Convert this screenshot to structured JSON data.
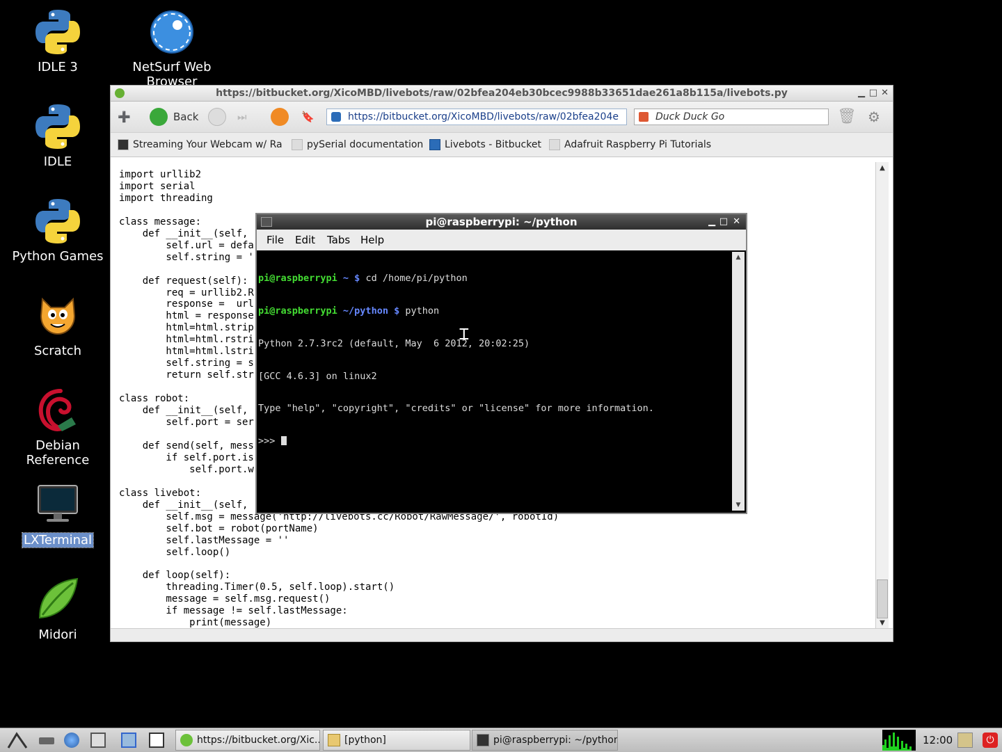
{
  "desktop": {
    "icons": [
      {
        "label": "IDLE 3"
      },
      {
        "label": "NetSurf Web Browser"
      },
      {
        "label": "IDLE"
      },
      {
        "label": "Python Games"
      },
      {
        "label": "Scratch"
      },
      {
        "label": "Debian Reference"
      },
      {
        "label": "LXTerminal"
      },
      {
        "label": "Midori"
      }
    ]
  },
  "browser": {
    "title": "https://bitbucket.org/XicoMBD/livebots/raw/02bfea204eb30bcec9988b33651dae261a8b115a/livebots.py",
    "back_label": "Back",
    "url": "https://bitbucket.org/XicoMBD/livebots/raw/02bfea204e",
    "search_engine": "Duck Duck Go",
    "bookmarks": [
      {
        "label": "Streaming Your Webcam w/ Ra"
      },
      {
        "label": "pySerial documentation"
      },
      {
        "label": "Livebots - Bitbucket"
      },
      {
        "label": "Adafruit Raspberry Pi Tutorials"
      }
    ],
    "code_lines": [
      "import urllib2",
      "import serial",
      "import threading",
      "",
      "class message:",
      "    def __init__(self,",
      "        self.url = defa",
      "        self.string = '",
      "",
      "    def request(self):",
      "        req = urllib2.R",
      "        response =  url",
      "        html = response",
      "        html=html.strip",
      "        html=html.rstri",
      "        html=html.lstri",
      "        self.string = s",
      "        return self.str",
      "",
      "class robot:",
      "    def __init__(self,",
      "        self.port = ser",
      "",
      "    def send(self, mess",
      "        if self.port.is",
      "            self.port.w",
      "",
      "class livebot:",
      "    def __init__(self,",
      "        self.msg = message('http://livebots.cc/Robot/RawMessage/', robotId)",
      "        self.bot = robot(portName)",
      "        self.lastMessage = ''",
      "        self.loop()",
      "",
      "    def loop(self):",
      "        threading.Timer(0.5, self.loop).start()",
      "        message = self.msg.request()",
      "        if message != self.lastMessage:",
      "            print(message)"
    ]
  },
  "terminal": {
    "title": "pi@raspberrypi: ~/python",
    "menu": [
      "File",
      "Edit",
      "Tabs",
      "Help"
    ],
    "lines": [
      {
        "user": "pi@raspberrypi",
        "path": " ~ $",
        "cmd": " cd /home/pi/python"
      },
      {
        "user": "pi@raspberrypi",
        "path": " ~/python $",
        "cmd": " python"
      },
      {
        "text": "Python 2.7.3rc2 (default, May  6 2012, 20:02:25)"
      },
      {
        "text": "[GCC 4.6.3] on linux2"
      },
      {
        "text": "Type \"help\", \"copyright\", \"credits\" or \"license\" for more information."
      },
      {
        "text": ">>> "
      }
    ]
  },
  "taskbar": {
    "tasks": [
      {
        "label": "https://bitbucket.org/Xic..."
      },
      {
        "label": "[python]"
      },
      {
        "label": "pi@raspberrypi: ~/python"
      }
    ],
    "clock": "12:00"
  }
}
